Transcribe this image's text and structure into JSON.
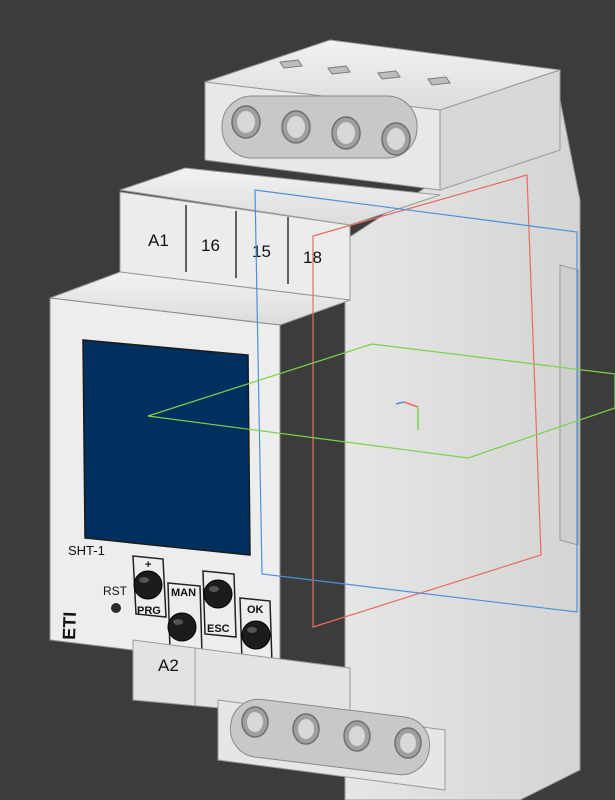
{
  "viewport": {
    "background_color": "#3c3c3c",
    "terminal_labels_top": [
      "A1",
      "16",
      "15",
      "18"
    ],
    "terminal_label_bottom": "A2",
    "model_label": "SHT-1",
    "brand_label": "ETI",
    "buttons": {
      "plus_label": "+",
      "prg_label": "PRG",
      "man_label": "MAN",
      "minus_label": "-",
      "esc_label": "ESC",
      "ok_label": "OK",
      "rst_label": "RST"
    },
    "display_color": "#00305f",
    "plane_colors": {
      "xy_plane": "#7ad24a",
      "xz_plane": "#ea6a62",
      "yz_plane": "#4d8fe0"
    }
  }
}
